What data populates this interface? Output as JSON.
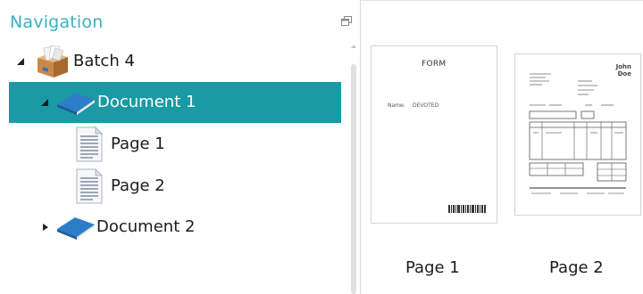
{
  "navigation": {
    "title": "Navigation",
    "tree": {
      "batch": {
        "label": "Batch 4",
        "expanded": true
      },
      "document1": {
        "label": "Document 1",
        "expanded": true,
        "selected": true
      },
      "page1": {
        "label": "Page 1"
      },
      "page2": {
        "label": "Page 2"
      },
      "document2": {
        "label": "Document 2",
        "expanded": false
      }
    }
  },
  "thumbnails": {
    "page1": {
      "caption": "Page 1",
      "heading": "FORM",
      "field_label": "Name:",
      "field_value": "DEVOTED"
    },
    "page2": {
      "caption": "Page 2",
      "logo_line1": "John",
      "logo_line2": "Doe"
    }
  },
  "colors": {
    "accent": "#3cb0c4",
    "selection": "#1a9aa5",
    "folder_blue": "#2c7ec8"
  },
  "icons": {
    "float": "float-window-icon",
    "batch": "batch-box-icon",
    "document": "book-icon",
    "page": "page-icon",
    "expanded": "expanded-triangle-icon",
    "collapsed": "collapsed-triangle-icon"
  }
}
